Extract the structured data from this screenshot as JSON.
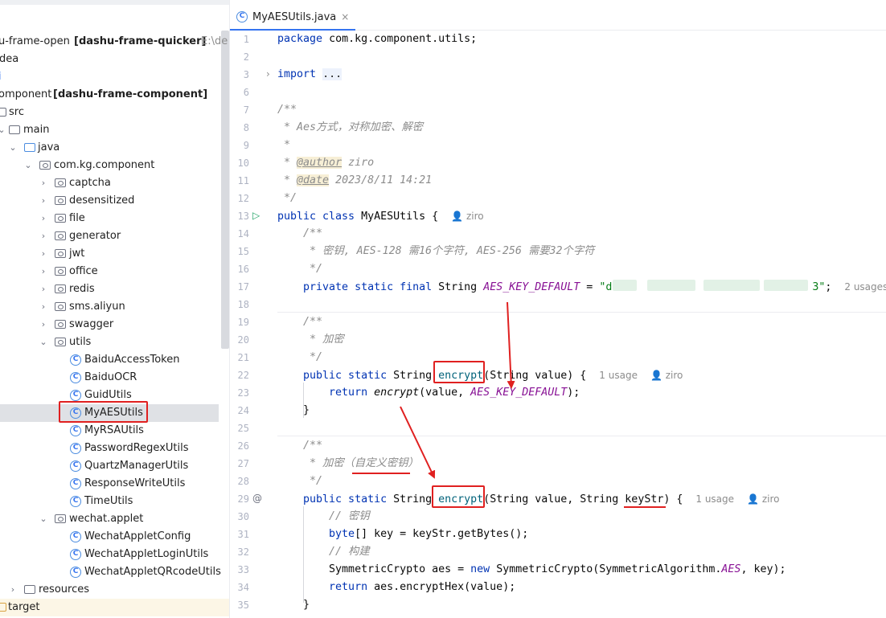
{
  "project_tree": {
    "root_label": "u-frame-open",
    "root_module": "[dashu-frame-quicker]",
    "root_path": "E:\\de",
    "idea_folder": "dea",
    "component_label": "omponent",
    "component_module": "[dashu-frame-component]",
    "src": "src",
    "main": "main",
    "java": "java",
    "package": "com.kg.component",
    "packages": [
      "captcha",
      "desensitized",
      "file",
      "generator",
      "jwt",
      "office",
      "redis",
      "sms.aliyun",
      "swagger"
    ],
    "utils": "utils",
    "utils_classes": [
      "BaiduAccessToken",
      "BaiduOCR",
      "GuidUtils",
      "MyAESUtils",
      "MyRSAUtils",
      "PasswordRegexUtils",
      "QuartzManagerUtils",
      "ResponseWriteUtils",
      "TimeUtils"
    ],
    "wechat": "wechat.applet",
    "wechat_classes": [
      "WechatAppletConfig",
      "WechatAppletLoginUtils",
      "WechatAppletQRcodeUtils"
    ],
    "resources": "resources",
    "target": "target"
  },
  "editor": {
    "tab_label": "MyAESUtils.java",
    "tab_close": "×",
    "line_numbers": [
      "1",
      "2",
      "3",
      "6",
      "7",
      "8",
      "9",
      "10",
      "11",
      "12",
      "13",
      "14",
      "15",
      "16",
      "17",
      "18",
      "19",
      "20",
      "21",
      "22",
      "23",
      "24",
      "25",
      "26",
      "27",
      "28",
      "29",
      "30",
      "31",
      "32",
      "33",
      "34",
      "35"
    ],
    "package_kw": "package",
    "package_name": "com.kg.component.utils;",
    "import_kw": "import",
    "import_fold": "...",
    "doc_open": "/**",
    "doc_line1": " * Aes方式，对称加密、解密",
    "doc_star": " *",
    "author_tag": "@author",
    "author_val": " ziro",
    "date_tag": "@date",
    "date_val": " 2023/8/11 14:21",
    "doc_close": " */",
    "class_decl_kw": "public class",
    "class_name": " MyAESUtils {",
    "class_author_hint": "ziro",
    "key_doc_open": "    /**",
    "key_doc_line": "     * 密钥, AES-128 需16个字符, AES-256 需要32个字符",
    "key_doc_close": "     */",
    "field_kw": "    private static final",
    "field_type": " String ",
    "field_name": "AES_KEY_DEFAULT",
    "field_eq": " = ",
    "field_val_start": "\"d",
    "field_val_end": "3\"",
    "field_semicolon": ";",
    "field_usages": "2 usages",
    "enc_doc_open": "    /**",
    "enc_doc_line": "     * 加密",
    "enc_doc_close": "     */",
    "enc1_kw": "    public static",
    "enc1_type": " String ",
    "enc1_name": "encrypt",
    "enc1_params": "(String value) {",
    "enc1_usages": "1 usage",
    "enc1_author": "ziro",
    "ret1_kw": "        return",
    "ret1_call": " encrypt",
    "ret1_args": "(value, ",
    "ret1_const": "AES_KEY_DEFAULT",
    "ret1_end": ");",
    "close1": "    }",
    "enc2_doc_open": "    /**",
    "enc2_doc_line": "     * 加密（自定义密钥）",
    "enc2_doc_close": "     */",
    "enc2_kw": "    public static",
    "enc2_type": " String ",
    "enc2_name": "encrypt",
    "enc2_params": "(String value, String keyStr) {",
    "enc2_usages": "1 usage",
    "enc2_author": "ziro",
    "c30": "        // 密钥",
    "c31_kw": "        byte",
    "c31_rest": "[] key = keyStr.getBytes();",
    "c32": "        // 构建",
    "c33_a": "        SymmetricCrypto aes = ",
    "c33_new": "new",
    "c33_b": " SymmetricCrypto(SymmetricAlgorithm.",
    "c33_aes": "AES",
    "c33_c": ", key);",
    "c34_kw": "        return",
    "c34_rest": " aes.encryptHex(value);",
    "c35": "    }"
  },
  "colors": {
    "annotation_red": "#e02020",
    "keyword_blue": "#0033b3",
    "selection_gray": "#dfe1e5"
  }
}
